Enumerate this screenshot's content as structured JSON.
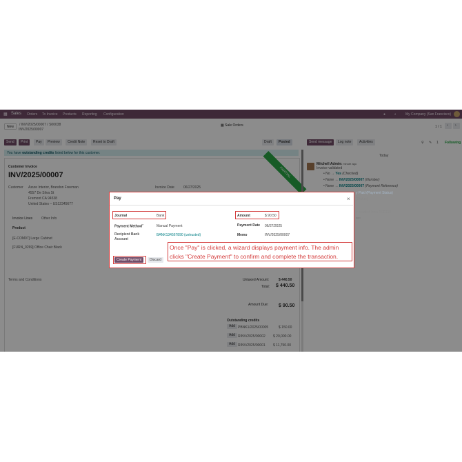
{
  "navbar": {
    "app": "Sales",
    "menu": [
      "Orders",
      "To Invoice",
      "Products",
      "Reporting",
      "Configuration"
    ],
    "company": "My Company (San Francisco)"
  },
  "control": {
    "new_label": "New",
    "breadcrumb": "/ INV/2025/00007 / S00038",
    "record": "INV/2025/00007",
    "sale_orders": "Sale Orders",
    "pager": "1 / 1"
  },
  "actions": {
    "send": "Send",
    "print": "Print",
    "pay": "Pay",
    "preview": "Preview",
    "credit_note": "Credit Note",
    "reset": "Reset to Draft",
    "status_draft": "Draft",
    "status_posted": "Posted"
  },
  "banner": {
    "pre": "You have ",
    "bold": "outstanding credits",
    "post": " listed below for this customer."
  },
  "invoice": {
    "type": "Customer Invoice",
    "number": "INV/2025/00007",
    "ribbon": "PARTIAL",
    "customer_label": "Customer",
    "customer_lines": [
      "Azure Interior, Brandon Freeman",
      "4557 De Silva St",
      "Fremont CA 94538",
      "United States – US12345677"
    ],
    "date_label": "Invoice Date",
    "date_value": "06/27/2025",
    "tabs": [
      "Invoice Lines",
      "Other Info"
    ],
    "product_header": "Product",
    "products": [
      "[E-COM07] Large Cabinet",
      "[FURN_0269] Office Chair Black"
    ],
    "terms": "Terms and Conditions",
    "untaxed_label": "Untaxed Amount:",
    "untaxed_value": "$ 440.50",
    "total_label": "Total:",
    "total_value": "$ 440.50",
    "due_label": "Amount Due:",
    "due_value": "$ 90.50",
    "credits_title": "Outstanding credits",
    "credits": [
      {
        "add": "Add",
        "ref": "PBNK1/2025/00005",
        "amount": "$ 150.00"
      },
      {
        "add": "Add",
        "ref": "RINV/2025/00002",
        "amount": "$ 20,000.00"
      },
      {
        "add": "Add",
        "ref": "RINV/2025/00001",
        "amount": "$ 11,750.00"
      }
    ]
  },
  "chatter": {
    "send_message": "Send message",
    "log_note": "Log note",
    "activities": "Activities",
    "follow": "Following",
    "followers_count": "1",
    "today": "Today",
    "author": "Mitchell Admin",
    "time": "1 minute ago",
    "msg": "Invoice validated",
    "changes": [
      {
        "from": "No",
        "to": "Yes",
        "field": "(Checked)"
      },
      {
        "from": "None",
        "to": "INV/2025/00007",
        "field": "(Number)"
      },
      {
        "from": "None",
        "to": "INV/2025/00007",
        "field": "(Payment Reference)"
      }
    ],
    "partial_line": "y Paid  (Payment Status)",
    "status_line": "(Status)",
    "created_line": "e created from S00038",
    "time2": "ago"
  },
  "modal": {
    "title": "Pay",
    "close": "×",
    "journal_label": "Journal",
    "journal_value": "Bank",
    "method_label": "Payment Method",
    "method_help": "?",
    "method_value": "Manual Payment",
    "recipient_label": "Recipient Bank Account",
    "recipient_value": "BANK134567890 (untrusted)",
    "amount_label": "Amount",
    "amount_value": "$ 90.50",
    "date_label": "Payment Date",
    "date_value": "06/27/2025",
    "memo_label": "Memo",
    "memo_value": "INV/2025/00007",
    "create_button": "Create Payment",
    "discard_button": "Discard"
  },
  "annotation": {
    "text": "Once \"Pay\" is clicked, a wizard displays payment info. The admin clicks \"Create Payment\" to confirm and complete the transaction."
  },
  "colors": {
    "brand": "#714b67",
    "annotation": "#d43c3c",
    "ribbon": "#28a745",
    "link": "#017e84"
  }
}
